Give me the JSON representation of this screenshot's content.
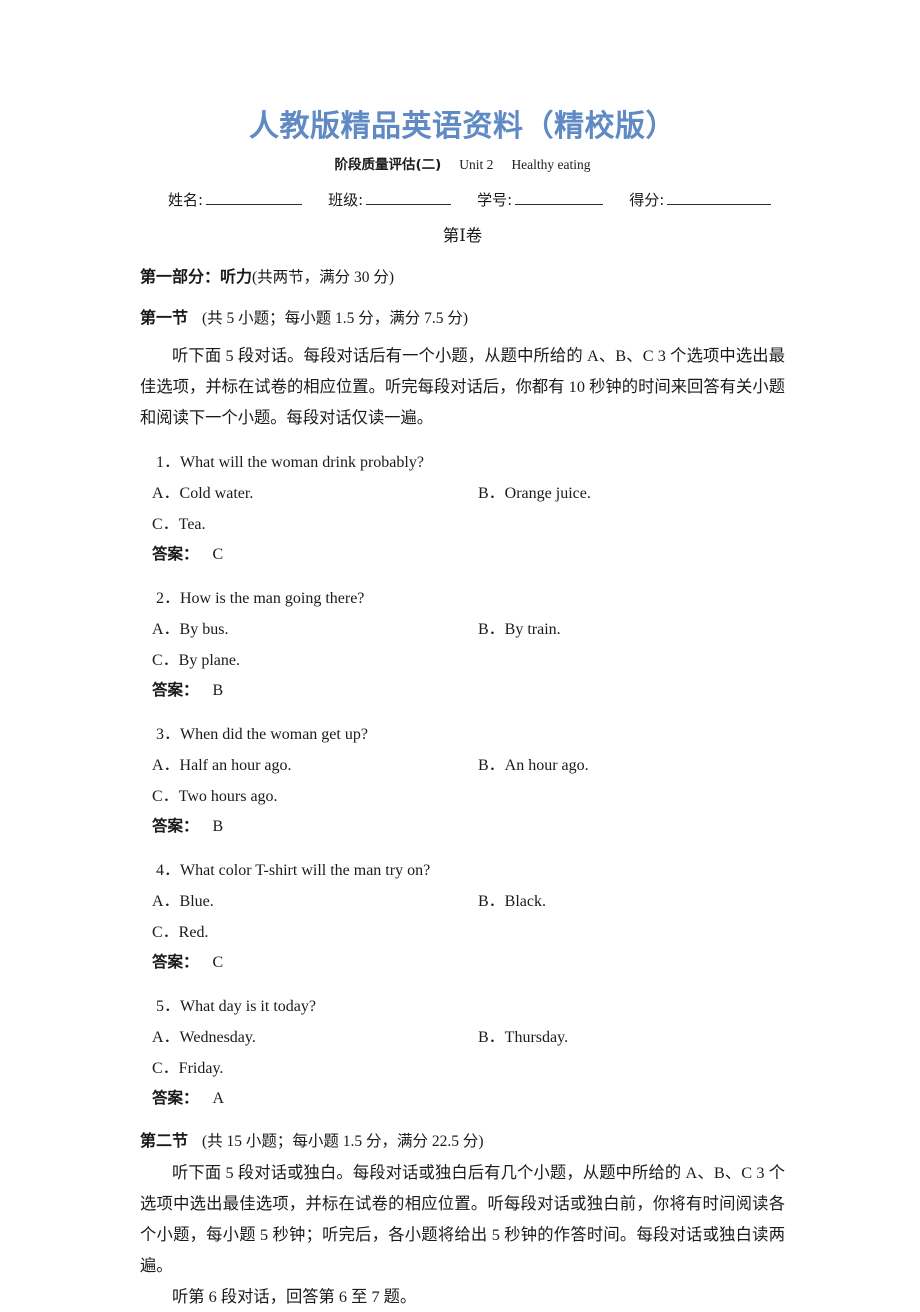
{
  "masthead": {
    "title": "人教版精品英语资料（精校版）",
    "color": "#5f8ac4"
  },
  "subtitle": {
    "assessment": "阶段质量评估(二)",
    "unit": "Unit 2",
    "topic": "Healthy eating"
  },
  "identity_row": {
    "name_label": "姓名:",
    "class_label": "班级:",
    "student_id_label": "学号:",
    "score_label": "得分:"
  },
  "paper_heading": "第Ⅰ卷",
  "part_one": {
    "heading_bold": "第一部分：听力",
    "heading_normal": "(共两节，满分 30 分)",
    "section_one_bold": "第一节",
    "section_one_normal": "(共 5 小题；每小题 1.5 分，满分 7.5 分)",
    "instructions": "听下面 5 段对话。每段对话后有一个小题，从题中所给的 A、B、C 3 个选项中选出最佳选项，并标在试卷的相应位置。听完每段对话后，你都有 10 秒钟的时间来回答有关小题和阅读下一个小题。每段对话仅读一遍。",
    "answer_label": "答案："
  },
  "questions": [
    {
      "stem": "1．What will the woman drink probably?",
      "a": "A．Cold water.",
      "b": "B．Orange juice.",
      "c": "C．Tea.",
      "answer": "C"
    },
    {
      "stem": "2．How is the man going there?",
      "a": "A．By bus.",
      "b": "B．By train.",
      "c": "C．By plane.",
      "answer": "B"
    },
    {
      "stem": "3．When did the woman get up?",
      "a": "A．Half an hour ago.",
      "b": "B．An hour ago.",
      "c": "C．Two hours ago.",
      "answer": "B"
    },
    {
      "stem": "4．What color T-shirt will the man try on?",
      "a": "A．Blue.",
      "b": "B．Black.",
      "c": "C．Red.",
      "answer": "C"
    },
    {
      "stem": "5．What day is it today?",
      "a": "A．Wednesday.",
      "b": "B．Thursday.",
      "c": "C．Friday.",
      "answer": "A"
    }
  ],
  "section_two": {
    "heading_bold": "第二节",
    "heading_normal": "(共 15 小题；每小题 1.5 分，满分 22.5 分)",
    "instructions": "听下面 5 段对话或独白。每段对话或独白后有几个小题，从题中所给的 A、B、C 3 个选项中选出最佳选项，并标在试卷的相应位置。听每段对话或独白前，你将有时间阅读各个小题，每小题 5 秒钟；听完后，各小题将给出 5 秒钟的作答时间。每段对话或独白读两遍。",
    "cue": "听第 6 段对话，回答第 6 至 7 题。"
  }
}
